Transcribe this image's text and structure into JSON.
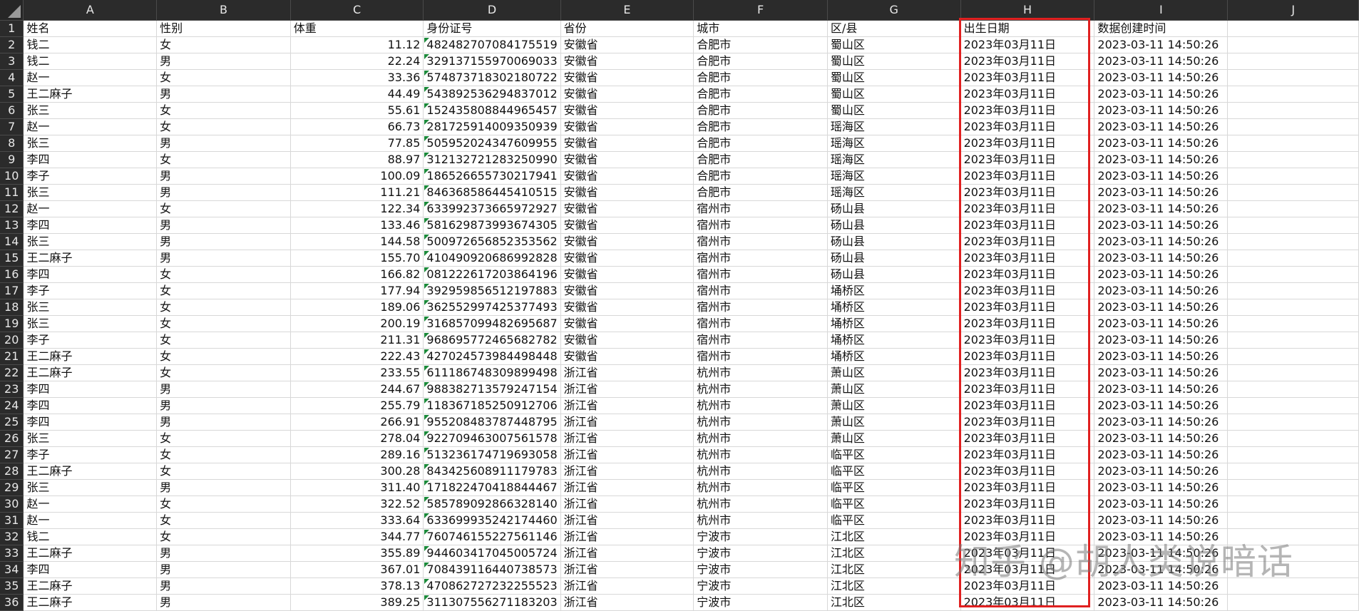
{
  "corner_label": "",
  "columns": [
    "A",
    "B",
    "C",
    "D",
    "E",
    "F",
    "G",
    "H",
    "I",
    "J"
  ],
  "rows": [
    {
      "n": "1",
      "A": "姓名",
      "B": "性别",
      "C": "体重",
      "D": "身份证号",
      "E": "省份",
      "F": "城市",
      "G": "区/县",
      "H": "出生日期",
      "I": "数据创建时间"
    },
    {
      "n": "2",
      "A": "钱二",
      "B": "女",
      "C": "11.12",
      "D": "482482707084175519",
      "E": "安徽省",
      "F": "合肥市",
      "G": "蜀山区",
      "H": "2023年03月11日",
      "I": "2023-03-11 14:50:26"
    },
    {
      "n": "3",
      "A": "钱二",
      "B": "男",
      "C": "22.24",
      "D": "329137155970069033",
      "E": "安徽省",
      "F": "合肥市",
      "G": "蜀山区",
      "H": "2023年03月11日",
      "I": "2023-03-11 14:50:26"
    },
    {
      "n": "4",
      "A": "赵一",
      "B": "女",
      "C": "33.36",
      "D": "574873718302180722",
      "E": "安徽省",
      "F": "合肥市",
      "G": "蜀山区",
      "H": "2023年03月11日",
      "I": "2023-03-11 14:50:26"
    },
    {
      "n": "5",
      "A": "王二麻子",
      "B": "男",
      "C": "44.49",
      "D": "543892536294837012",
      "E": "安徽省",
      "F": "合肥市",
      "G": "蜀山区",
      "H": "2023年03月11日",
      "I": "2023-03-11 14:50:26"
    },
    {
      "n": "6",
      "A": "张三",
      "B": "女",
      "C": "55.61",
      "D": "152435808844965457",
      "E": "安徽省",
      "F": "合肥市",
      "G": "蜀山区",
      "H": "2023年03月11日",
      "I": "2023-03-11 14:50:26"
    },
    {
      "n": "7",
      "A": "赵一",
      "B": "女",
      "C": "66.73",
      "D": "281725914009350939",
      "E": "安徽省",
      "F": "合肥市",
      "G": "瑶海区",
      "H": "2023年03月11日",
      "I": "2023-03-11 14:50:26"
    },
    {
      "n": "8",
      "A": "张三",
      "B": "男",
      "C": "77.85",
      "D": "505952024347609955",
      "E": "安徽省",
      "F": "合肥市",
      "G": "瑶海区",
      "H": "2023年03月11日",
      "I": "2023-03-11 14:50:26"
    },
    {
      "n": "9",
      "A": "李四",
      "B": "女",
      "C": "88.97",
      "D": "312132721283250990",
      "E": "安徽省",
      "F": "合肥市",
      "G": "瑶海区",
      "H": "2023年03月11日",
      "I": "2023-03-11 14:50:26"
    },
    {
      "n": "10",
      "A": "李子",
      "B": "男",
      "C": "100.09",
      "D": "186526655730217941",
      "E": "安徽省",
      "F": "合肥市",
      "G": "瑶海区",
      "H": "2023年03月11日",
      "I": "2023-03-11 14:50:26"
    },
    {
      "n": "11",
      "A": "张三",
      "B": "男",
      "C": "111.21",
      "D": "846368586445410515",
      "E": "安徽省",
      "F": "合肥市",
      "G": "瑶海区",
      "H": "2023年03月11日",
      "I": "2023-03-11 14:50:26"
    },
    {
      "n": "12",
      "A": "赵一",
      "B": "女",
      "C": "122.34",
      "D": "633992373665972927",
      "E": "安徽省",
      "F": "宿州市",
      "G": "砀山县",
      "H": "2023年03月11日",
      "I": "2023-03-11 14:50:26"
    },
    {
      "n": "13",
      "A": "李四",
      "B": "男",
      "C": "133.46",
      "D": "581629873993674305",
      "E": "安徽省",
      "F": "宿州市",
      "G": "砀山县",
      "H": "2023年03月11日",
      "I": "2023-03-11 14:50:26"
    },
    {
      "n": "14",
      "A": "张三",
      "B": "男",
      "C": "144.58",
      "D": "500972656852353562",
      "E": "安徽省",
      "F": "宿州市",
      "G": "砀山县",
      "H": "2023年03月11日",
      "I": "2023-03-11 14:50:26"
    },
    {
      "n": "15",
      "A": "王二麻子",
      "B": "男",
      "C": "155.70",
      "D": "410490920686992828",
      "E": "安徽省",
      "F": "宿州市",
      "G": "砀山县",
      "H": "2023年03月11日",
      "I": "2023-03-11 14:50:26"
    },
    {
      "n": "16",
      "A": "李四",
      "B": "女",
      "C": "166.82",
      "D": "081222617203864196",
      "E": "安徽省",
      "F": "宿州市",
      "G": "砀山县",
      "H": "2023年03月11日",
      "I": "2023-03-11 14:50:26"
    },
    {
      "n": "17",
      "A": "李子",
      "B": "女",
      "C": "177.94",
      "D": "392959856512197883",
      "E": "安徽省",
      "F": "宿州市",
      "G": "埇桥区",
      "H": "2023年03月11日",
      "I": "2023-03-11 14:50:26"
    },
    {
      "n": "18",
      "A": "张三",
      "B": "女",
      "C": "189.06",
      "D": "362552997425377493",
      "E": "安徽省",
      "F": "宿州市",
      "G": "埇桥区",
      "H": "2023年03月11日",
      "I": "2023-03-11 14:50:26"
    },
    {
      "n": "19",
      "A": "张三",
      "B": "女",
      "C": "200.19",
      "D": "316857099482695687",
      "E": "安徽省",
      "F": "宿州市",
      "G": "埇桥区",
      "H": "2023年03月11日",
      "I": "2023-03-11 14:50:26"
    },
    {
      "n": "20",
      "A": "李子",
      "B": "女",
      "C": "211.31",
      "D": "968695772465682782",
      "E": "安徽省",
      "F": "宿州市",
      "G": "埇桥区",
      "H": "2023年03月11日",
      "I": "2023-03-11 14:50:26"
    },
    {
      "n": "21",
      "A": "王二麻子",
      "B": "女",
      "C": "222.43",
      "D": "427024573984498448",
      "E": "安徽省",
      "F": "宿州市",
      "G": "埇桥区",
      "H": "2023年03月11日",
      "I": "2023-03-11 14:50:26"
    },
    {
      "n": "22",
      "A": "王二麻子",
      "B": "女",
      "C": "233.55",
      "D": "611186748309899498",
      "E": "浙江省",
      "F": "杭州市",
      "G": "萧山区",
      "H": "2023年03月11日",
      "I": "2023-03-11 14:50:26"
    },
    {
      "n": "23",
      "A": "李四",
      "B": "男",
      "C": "244.67",
      "D": "988382713579247154",
      "E": "浙江省",
      "F": "杭州市",
      "G": "萧山区",
      "H": "2023年03月11日",
      "I": "2023-03-11 14:50:26"
    },
    {
      "n": "24",
      "A": "李四",
      "B": "男",
      "C": "255.79",
      "D": "118367185250912706",
      "E": "浙江省",
      "F": "杭州市",
      "G": "萧山区",
      "H": "2023年03月11日",
      "I": "2023-03-11 14:50:26"
    },
    {
      "n": "25",
      "A": "李四",
      "B": "男",
      "C": "266.91",
      "D": "955208483787448795",
      "E": "浙江省",
      "F": "杭州市",
      "G": "萧山区",
      "H": "2023年03月11日",
      "I": "2023-03-11 14:50:26"
    },
    {
      "n": "26",
      "A": "张三",
      "B": "女",
      "C": "278.04",
      "D": "922709463007561578",
      "E": "浙江省",
      "F": "杭州市",
      "G": "萧山区",
      "H": "2023年03月11日",
      "I": "2023-03-11 14:50:26"
    },
    {
      "n": "27",
      "A": "李子",
      "B": "女",
      "C": "289.16",
      "D": "513236174719693058",
      "E": "浙江省",
      "F": "杭州市",
      "G": "临平区",
      "H": "2023年03月11日",
      "I": "2023-03-11 14:50:26"
    },
    {
      "n": "28",
      "A": "王二麻子",
      "B": "女",
      "C": "300.28",
      "D": "843425608911179783",
      "E": "浙江省",
      "F": "杭州市",
      "G": "临平区",
      "H": "2023年03月11日",
      "I": "2023-03-11 14:50:26"
    },
    {
      "n": "29",
      "A": "张三",
      "B": "男",
      "C": "311.40",
      "D": "171822470418844467",
      "E": "浙江省",
      "F": "杭州市",
      "G": "临平区",
      "H": "2023年03月11日",
      "I": "2023-03-11 14:50:26"
    },
    {
      "n": "30",
      "A": "赵一",
      "B": "女",
      "C": "322.52",
      "D": "585789092866328140",
      "E": "浙江省",
      "F": "杭州市",
      "G": "临平区",
      "H": "2023年03月11日",
      "I": "2023-03-11 14:50:26"
    },
    {
      "n": "31",
      "A": "赵一",
      "B": "女",
      "C": "333.64",
      "D": "633699935242174460",
      "E": "浙江省",
      "F": "杭州市",
      "G": "临平区",
      "H": "2023年03月11日",
      "I": "2023-03-11 14:50:26"
    },
    {
      "n": "32",
      "A": "钱二",
      "B": "女",
      "C": "344.77",
      "D": "760746155227561146",
      "E": "浙江省",
      "F": "宁波市",
      "G": "江北区",
      "H": "2023年03月11日",
      "I": "2023-03-11 14:50:26"
    },
    {
      "n": "33",
      "A": "王二麻子",
      "B": "男",
      "C": "355.89",
      "D": "944603417045005724",
      "E": "浙江省",
      "F": "宁波市",
      "G": "江北区",
      "H": "2023年03月11日",
      "I": "2023-03-11 14:50:26"
    },
    {
      "n": "34",
      "A": "李四",
      "B": "男",
      "C": "367.01",
      "D": "708439116440738573",
      "E": "浙江省",
      "F": "宁波市",
      "G": "江北区",
      "H": "2023年03月11日",
      "I": "2023-03-11 14:50:26"
    },
    {
      "n": "35",
      "A": "王二麻子",
      "B": "男",
      "C": "378.13",
      "D": "470862727232255523",
      "E": "浙江省",
      "F": "宁波市",
      "G": "江北区",
      "H": "2023年03月11日",
      "I": "2023-03-11 14:50:26"
    },
    {
      "n": "36",
      "A": "王二麻子",
      "B": "男",
      "C": "389.25",
      "D": "311307556271183203",
      "E": "浙江省",
      "F": "宁波市",
      "G": "江北区",
      "H": "2023年03月11日",
      "I": "2023-03-11 14:50:26"
    }
  ],
  "watermark": "知乎 @胡人类说暗话",
  "colors": {
    "highlight": "#e02020",
    "header_bg": "#2b2b2b",
    "error_marker": "#1b8a3a"
  }
}
